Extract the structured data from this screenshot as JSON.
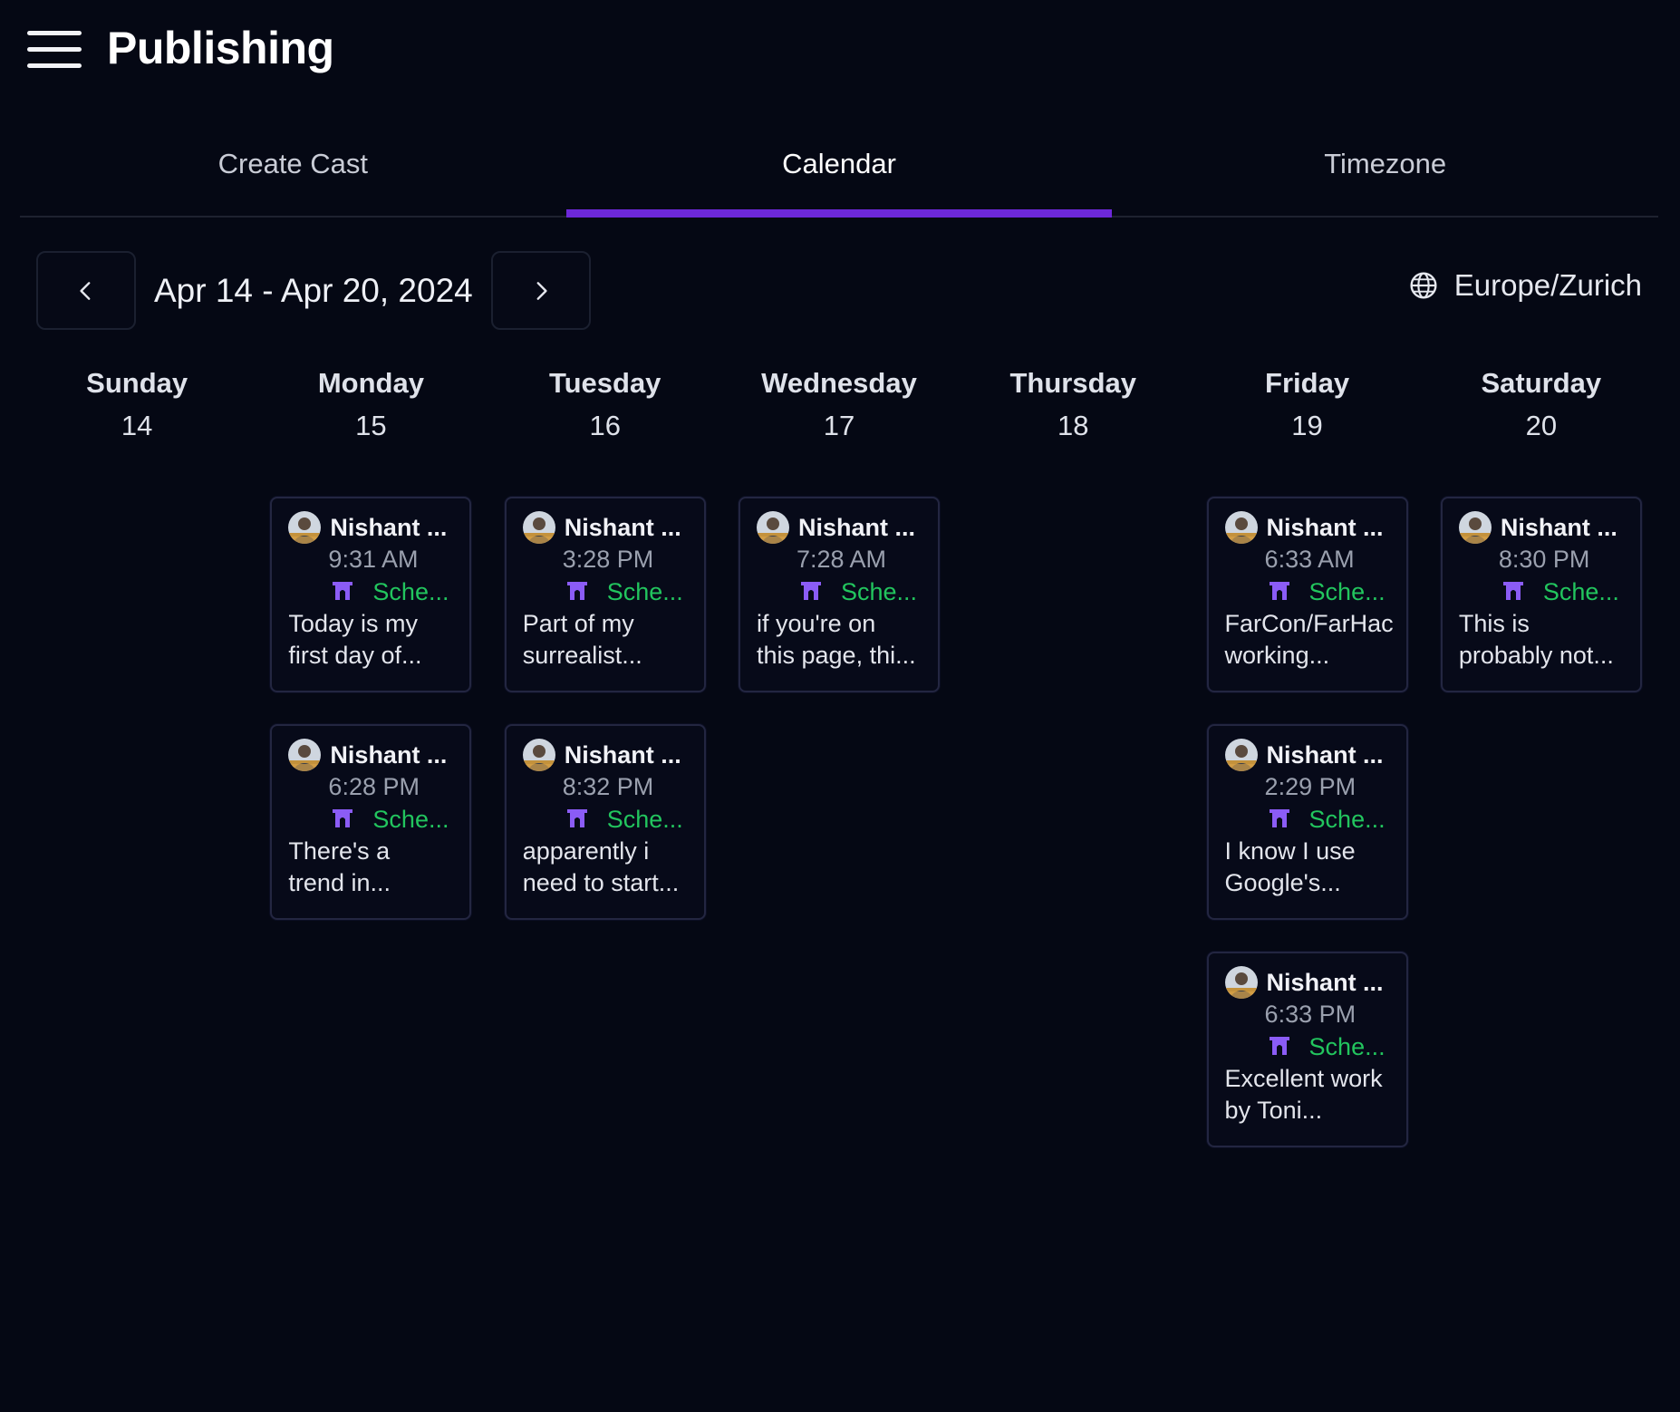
{
  "header": {
    "title": "Publishing",
    "menu_icon": "hamburger-menu-icon"
  },
  "tabs": [
    {
      "label": "Create Cast",
      "active": false
    },
    {
      "label": "Calendar",
      "active": true
    },
    {
      "label": "Timezone",
      "active": false
    }
  ],
  "colors": {
    "accent": "#6d28d9",
    "status": "#22c55e",
    "background": "#050814",
    "channel_icon": "#8b5cf6"
  },
  "week": {
    "range": "Apr 14 - Apr 20, 2024",
    "prev_icon": "chevron-left-icon",
    "next_icon": "chevron-right-icon",
    "timezone": "Europe/Zurich",
    "timezone_icon": "globe-icon"
  },
  "days": [
    {
      "name": "Sunday",
      "num": "14",
      "posts": []
    },
    {
      "name": "Monday",
      "num": "15",
      "posts": [
        {
          "author": "Nishant ...",
          "time": "9:31 AM",
          "status": "Sche...",
          "line1": "Today is my",
          "line2": "first day of..."
        },
        {
          "author": "Nishant ...",
          "time": "6:28 PM",
          "status": "Sche...",
          "line1": "There's a",
          "line2": "trend in..."
        }
      ]
    },
    {
      "name": "Tuesday",
      "num": "16",
      "posts": [
        {
          "author": "Nishant ...",
          "time": "3:28 PM",
          "status": "Sche...",
          "line1": "Part of my",
          "line2": "surrealist..."
        },
        {
          "author": "Nishant ...",
          "time": "8:32 PM",
          "status": "Sche...",
          "line1": "apparently i",
          "line2": "need to start..."
        }
      ]
    },
    {
      "name": "Wednesday",
      "num": "17",
      "posts": [
        {
          "author": "Nishant ...",
          "time": "7:28 AM",
          "status": "Sche...",
          "line1": "if you're on",
          "line2": "this page, thi..."
        }
      ]
    },
    {
      "name": "Thursday",
      "num": "18",
      "posts": []
    },
    {
      "name": "Friday",
      "num": "19",
      "posts": [
        {
          "author": "Nishant ...",
          "time": "6:33 AM",
          "status": "Sche...",
          "line1": "FarCon/FarHac",
          "line2": "working..."
        },
        {
          "author": "Nishant ...",
          "time": "2:29 PM",
          "status": "Sche...",
          "line1": "I know I use",
          "line2": "Google's..."
        },
        {
          "author": "Nishant ...",
          "time": "6:33 PM",
          "status": "Sche...",
          "line1": "Excellent work",
          "line2": "by Toni..."
        }
      ]
    },
    {
      "name": "Saturday",
      "num": "20",
      "posts": [
        {
          "author": "Nishant ...",
          "time": "8:30 PM",
          "status": "Sche...",
          "line1": "This is",
          "line2": "probably not..."
        }
      ]
    }
  ]
}
